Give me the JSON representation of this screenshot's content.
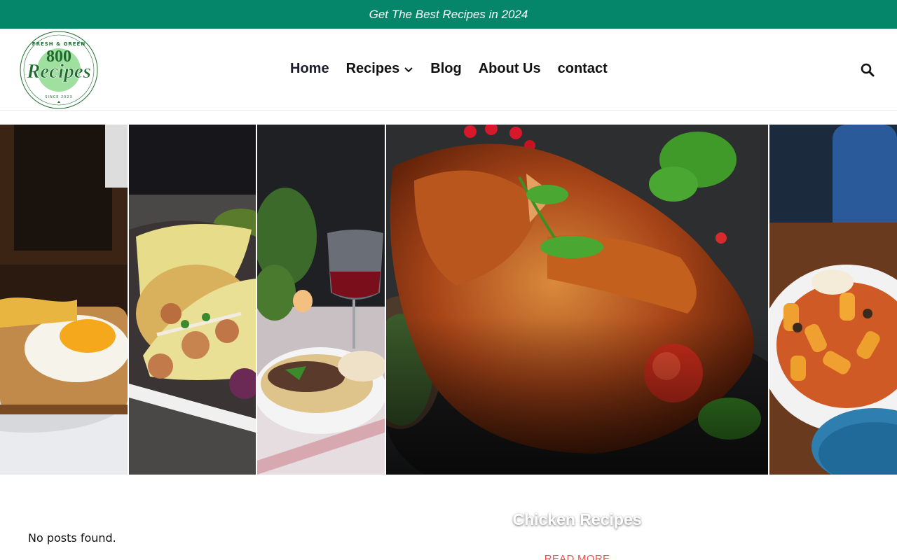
{
  "topbar": {
    "text": "Get The Best Recipes in 2024"
  },
  "logo": {
    "top_text": "FRESH & GREEN",
    "number": "800",
    "word": "Recipes",
    "bottom_text": "SINCE 2023"
  },
  "nav": {
    "items": [
      {
        "label": "Home"
      },
      {
        "label": "Recipes"
      },
      {
        "label": "Blog"
      },
      {
        "label": "About Us"
      },
      {
        "label": "contact"
      }
    ]
  },
  "icons": {
    "search": "search-icon",
    "dropdown": "chevron-down-icon"
  },
  "slider": {
    "slides": [
      {
        "subject": "fried egg on toast"
      },
      {
        "subject": "shrimp tacos"
      },
      {
        "subject": "pasta with wine"
      },
      {
        "subject": "roast chicken"
      },
      {
        "subject": "rigatoni pasta"
      }
    ],
    "active_caption": "Chicken Recipes",
    "read_more": "READ MORE"
  },
  "main": {
    "empty_message": "No posts found."
  },
  "colors": {
    "brand_green": "#05856a",
    "accent_red": "#e8554e",
    "logo_green": "#1f6b2e"
  }
}
